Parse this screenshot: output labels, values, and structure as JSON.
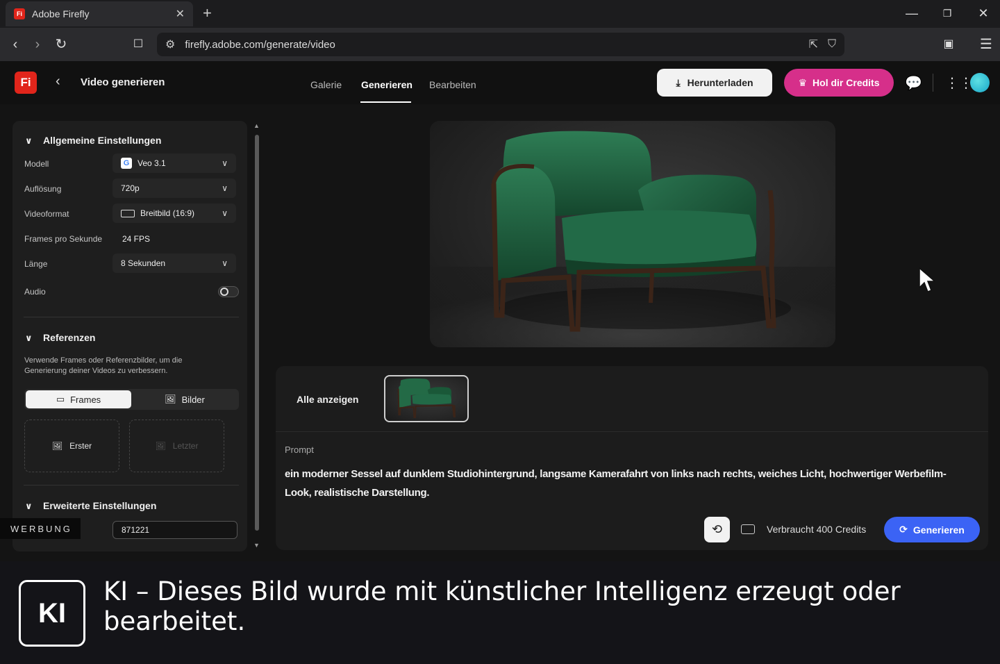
{
  "browser": {
    "tab_title": "Adobe Firefly",
    "tab_favicon": "Fi",
    "url": "firefly.adobe.com/generate/video"
  },
  "header": {
    "logo": "Fi",
    "title": "Video generieren",
    "nav": [
      "Galerie",
      "Generieren",
      "Bearbeiten"
    ],
    "active_nav": "Generieren",
    "download_label": "Herunterladen",
    "credits_label": "Hol dir Credits"
  },
  "settings": {
    "general_title": "Allgemeine Einstellungen",
    "rows": {
      "model_label": "Modell",
      "model_value": "Veo 3.1",
      "model_badge": "G",
      "resolution_label": "Auflösung",
      "resolution_value": "720p",
      "format_label": "Videoformat",
      "format_value": "Breitbild (16:9)",
      "fps_label": "Frames pro Sekunde",
      "fps_value": "24 FPS",
      "length_label": "Länge",
      "length_value": "8 Sekunden",
      "audio_label": "Audio"
    },
    "audio_enabled": false,
    "references_title": "Referenzen",
    "references_desc": "Verwende Frames oder Referenzbilder, um die Generierung deiner Videos zu verbessern.",
    "seg_frames": "Frames",
    "seg_images": "Bilder",
    "first_frame": "Erster",
    "last_frame": "Letzter",
    "advanced_title": "Erweiterte Einstellungen",
    "seed_value": "871221"
  },
  "ad_label": "WERBUNG",
  "results": {
    "show_all": "Alle anzeigen",
    "prompt_label": "Prompt",
    "prompt_text": "ein moderner Sessel auf dunklem Studiohintergrund, langsame Kamerafahrt von links nach rechts, weiches Licht, hochwertiger Werbefilm-Look, realistische Darstellung.",
    "credits_used": "Verbraucht 400 Credits",
    "generate_label": "Generieren"
  },
  "disclaimer": {
    "badge": "KI",
    "text": "KI – Dieses Bild wurde mit künstlicher Intelligenz erzeugt oder bearbeitet."
  },
  "colors": {
    "brand_red": "#e1251b",
    "credits_pink": "#d62f8a",
    "generate_blue": "#3b63f5",
    "chair_green": "#1f5e3e"
  }
}
